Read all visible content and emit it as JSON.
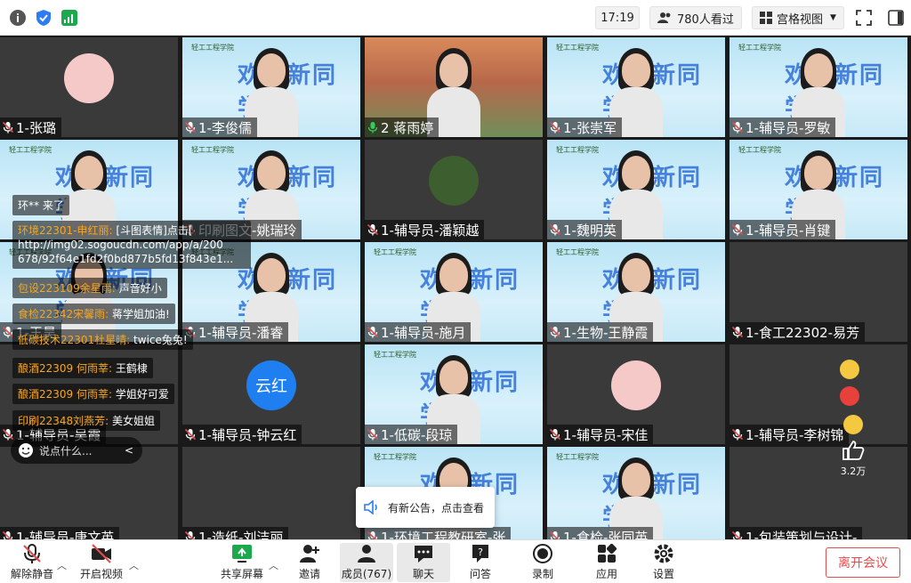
{
  "topbar": {
    "time": "17:19",
    "viewers": "780人看过",
    "view_mode": "宫格视图",
    "icons": [
      "info-icon",
      "shield-icon",
      "signal-icon",
      "viewers-icon",
      "grid-icon",
      "fullscreen-icon",
      "sidebar-icon"
    ]
  },
  "tiles": [
    {
      "name": "1-张璐",
      "bg": "dark"
    },
    {
      "name": "1-李俊儒",
      "bg": "banner"
    },
    {
      "name": "2 蒋雨婷",
      "bg": "room"
    },
    {
      "name": "1-张崇军",
      "bg": "banner"
    },
    {
      "name": "1-辅导员-罗敏",
      "bg": "banner"
    },
    {
      "name": "",
      "bg": "banner"
    },
    {
      "name": "印刷图文-姚瑞玲",
      "bg": "banner"
    },
    {
      "name": "1-辅导员-潘颖越",
      "bg": "dark"
    },
    {
      "name": "1-魏明英",
      "bg": "banner"
    },
    {
      "name": "1-辅导员-肖键",
      "bg": "banner"
    },
    {
      "name": "1-王昊",
      "bg": "banner"
    },
    {
      "name": "1-辅导员-潘睿",
      "bg": "banner"
    },
    {
      "name": "1-辅导员-施月",
      "bg": "banner"
    },
    {
      "name": "1-生物-王静霞",
      "bg": "banner"
    },
    {
      "name": "1-食工22302-易芳",
      "bg": "dark"
    },
    {
      "name": "1-辅导员-吴霞",
      "bg": "dark"
    },
    {
      "name": "1-辅导员-钟云红",
      "bg": "dark"
    },
    {
      "name": "1-低碳-段琼",
      "bg": "banner"
    },
    {
      "name": "1-辅导员-宋佳",
      "bg": "dark"
    },
    {
      "name": "1-辅导员-李树锦",
      "bg": "dark"
    },
    {
      "name": "1-辅导员-唐文英",
      "bg": "dark"
    },
    {
      "name": "1-造纸-刘洁丽",
      "bg": "dark"
    },
    {
      "name": "1-环境工程教研室-张",
      "bg": "banner"
    },
    {
      "name": "1-食检-张同英",
      "bg": "banner"
    },
    {
      "name": "1-包装策划与设计-",
      "bg": "dark"
    }
  ],
  "banner_text": "欢迎新同学",
  "banner_logo": "轻工工程学院",
  "avatar_text": "云红",
  "chat": {
    "join": "环** 来了",
    "messages": [
      {
        "user": "环境22301-申红丽:",
        "text": "[斗图表情]点击[",
        "extra": "http://img02.sogoucdn.com/app/a/200",
        "extra2": "678/92f64e1fd2f0bd877b5fd13f843e1..."
      },
      {
        "user": "包设223109余星雨:",
        "text": "声音好小"
      },
      {
        "user": "食检22342宋馨雨:",
        "text": "蒋学姐加油!"
      },
      {
        "user": "低碳技术22301杜星晴:",
        "text": "twice兔兔!"
      },
      {
        "user": "酿酒22309 何雨莘:",
        "text": "王鹤棣"
      },
      {
        "user": "酿酒22309 何雨莘:",
        "text": "学姐好可爱"
      },
      {
        "user": "印刷22348刘燕芳:",
        "text": "美女姐姐"
      }
    ],
    "input_placeholder": "说点什么...",
    "collapse": "<"
  },
  "notice": "有新公告，点击查看",
  "likes": "3.2万",
  "toolbar": {
    "items": [
      {
        "label": "解除静音",
        "icon": "mic-muted-icon"
      },
      {
        "label": "开启视频",
        "icon": "camera-off-icon"
      },
      {
        "label": "共享屏幕",
        "icon": "share-screen-icon"
      },
      {
        "label": "邀请",
        "icon": "invite-icon"
      },
      {
        "label": "成员(767)",
        "icon": "members-icon"
      },
      {
        "label": "聊天",
        "icon": "chat-icon"
      },
      {
        "label": "问答",
        "icon": "qa-icon"
      },
      {
        "label": "录制",
        "icon": "record-icon"
      },
      {
        "label": "应用",
        "icon": "apps-icon"
      },
      {
        "label": "设置",
        "icon": "settings-icon"
      }
    ],
    "leave": "离开会议"
  },
  "colors": {
    "accent": "#1aa94c",
    "leave": "#e34d4d",
    "banner_blue": "#2f6fd6"
  }
}
